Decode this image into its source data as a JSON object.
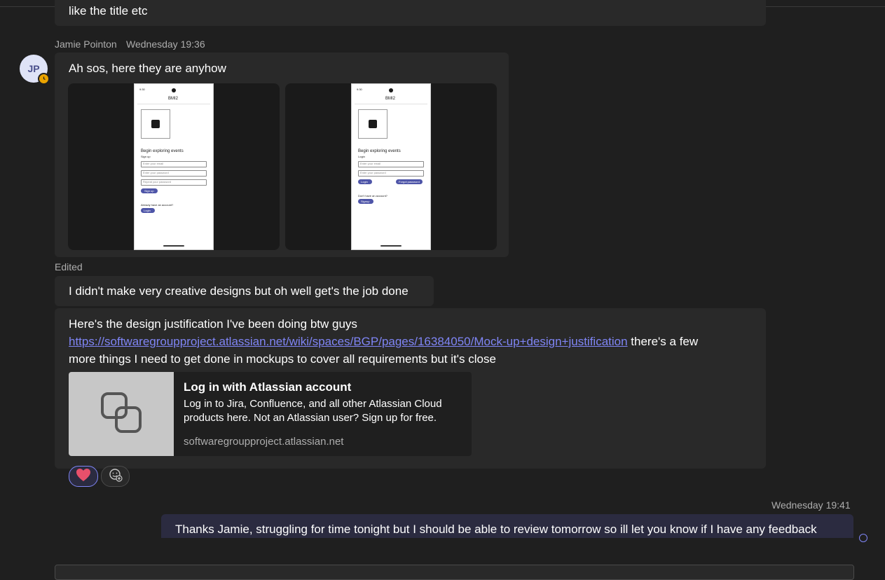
{
  "messages": [
    {
      "text": "like the title etc"
    },
    {
      "sender": "Jamie Pointon",
      "initials": "JP",
      "timestamp": "Wednesday 19:36",
      "text": "Ah sos, here they are anyhow",
      "images": [
        {
          "status_time": "9:30",
          "app_title": "BMI2",
          "heading": "Begin exploring events",
          "subheading": "Sign up",
          "fields": [
            "Enter your email",
            "Enter your password",
            "Repeat your password"
          ],
          "primary_button": "Sign up",
          "secondary_prompt": "Already have an account?",
          "secondary_button": "Login"
        },
        {
          "status_time": "9:30",
          "app_title": "BMI2",
          "heading": "Begin exploring events",
          "subheading": "Login",
          "fields": [
            "Enter your email",
            "Enter your password"
          ],
          "primary_button": "Login",
          "extra_button": "Forgot password",
          "secondary_prompt": "Don't have an account?",
          "secondary_button": "Signup"
        }
      ]
    },
    {
      "edited_label": "Edited",
      "text": "I didn't make very creative designs but oh well get's the job done"
    },
    {
      "text_line1": "Here's the design justification I've been doing btw guys",
      "link": "https://softwaregroupproject.atlassian.net/wiki/spaces/BGP/pages/16384050/Mock-up+design+justification",
      "text_after_link": " there's a few",
      "text_line3": "more things I need to get done in mockups to cover all requirements but it's close",
      "preview": {
        "title": "Log in with Atlassian account",
        "description": "Log in to Jira, Confluence, and all other Atlassian Cloud products here. Not an Atlassian user? Sign up for free.",
        "domain": "softwaregroupproject.atlassian.net",
        "icon": "link-icon"
      },
      "reactions": [
        {
          "icon": "heart-icon",
          "color": "#e8506b"
        },
        {
          "icon": "add-reaction-icon"
        }
      ]
    },
    {
      "own": true,
      "timestamp": "Wednesday 19:41",
      "text": "Thanks Jamie, struggling for time tonight but I should be able to review tomorrow so ill let you know if I have any feedback"
    }
  ],
  "colors": {
    "background": "#1f1f1f",
    "bubble": "#292929",
    "own_bubble": "#2b2b40",
    "accent": "#7f85f5",
    "presence_away": "#eaa300"
  }
}
